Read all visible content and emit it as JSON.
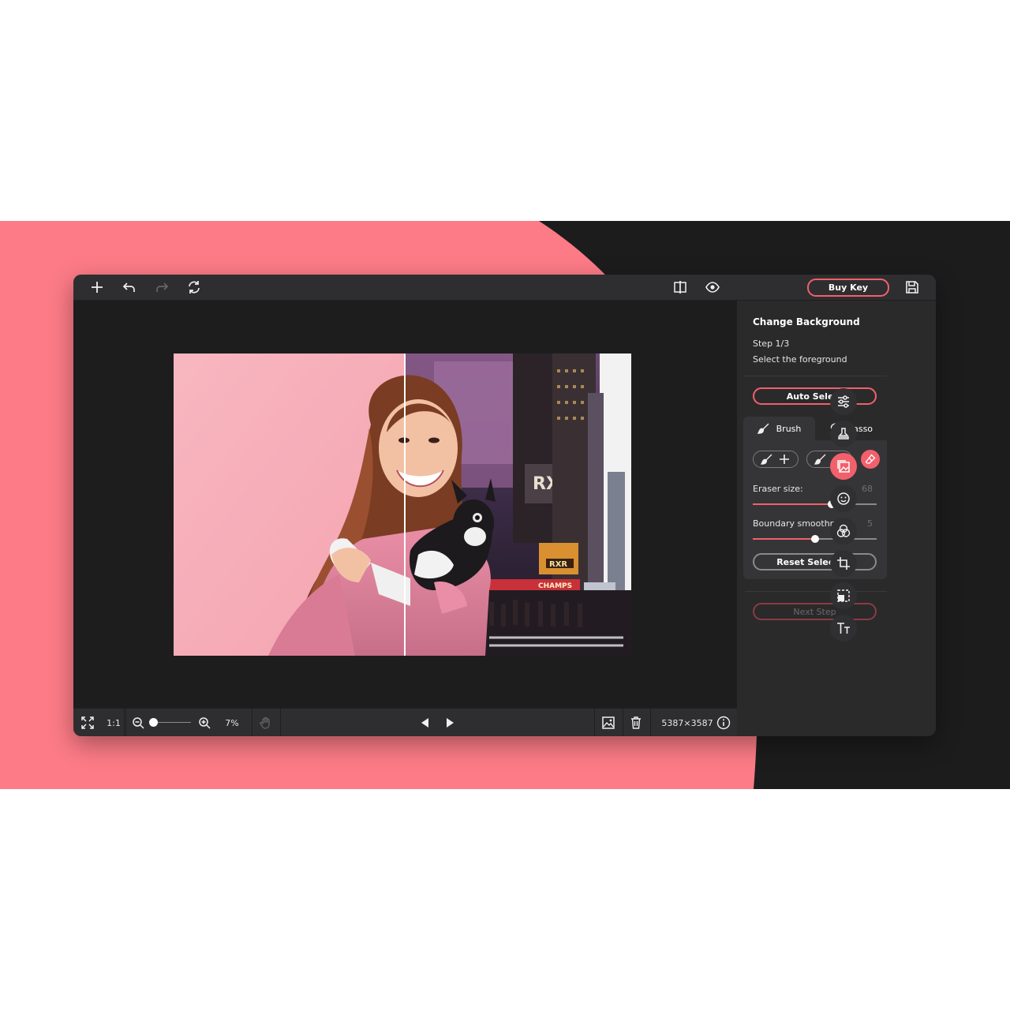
{
  "colors": {
    "accent": "#f2606c",
    "banner_pink": "#fc7b86",
    "banner_dark": "#1c1c1d",
    "app_bg": "#2a2a2b",
    "canvas_bg": "#1d1d1e"
  },
  "toolbar": {
    "icons": [
      "add-icon",
      "undo-icon",
      "redo-icon",
      "sync-icon",
      "compare-icon",
      "eye-icon",
      "save-icon"
    ],
    "buy_key_label": "Buy Key"
  },
  "panel": {
    "title": "Change Background",
    "step": "Step 1/3",
    "description": "Select the foreground",
    "auto_select_label": "Auto Select",
    "tabs": [
      {
        "label": "Brush",
        "icon": "brush-icon",
        "active": true
      },
      {
        "label": "Lasso",
        "icon": "lasso-icon",
        "active": false
      }
    ],
    "sliders": [
      {
        "label": "Eraser size:",
        "value": "68",
        "level": 0.64
      },
      {
        "label": "Boundary smoothness",
        "value": "5",
        "level": 0.5
      }
    ],
    "reset_label": "Reset Selection",
    "next_label": "Next Step"
  },
  "rail": {
    "icons": [
      "adjust-icon",
      "stamp-icon",
      "change-background-icon",
      "face-icon",
      "color-filter-icon",
      "crop-icon",
      "resize-icon",
      "text-icon"
    ],
    "active_index": 2
  },
  "bottom": {
    "ratio_label": "1:1",
    "zoom_label": "7%",
    "zoom_level": 0.05,
    "dimensions": "5387×3587"
  },
  "photo": {
    "left_caption": "RXR",
    "billboard_text": "CHAMPS",
    "small_text": "RXR"
  }
}
